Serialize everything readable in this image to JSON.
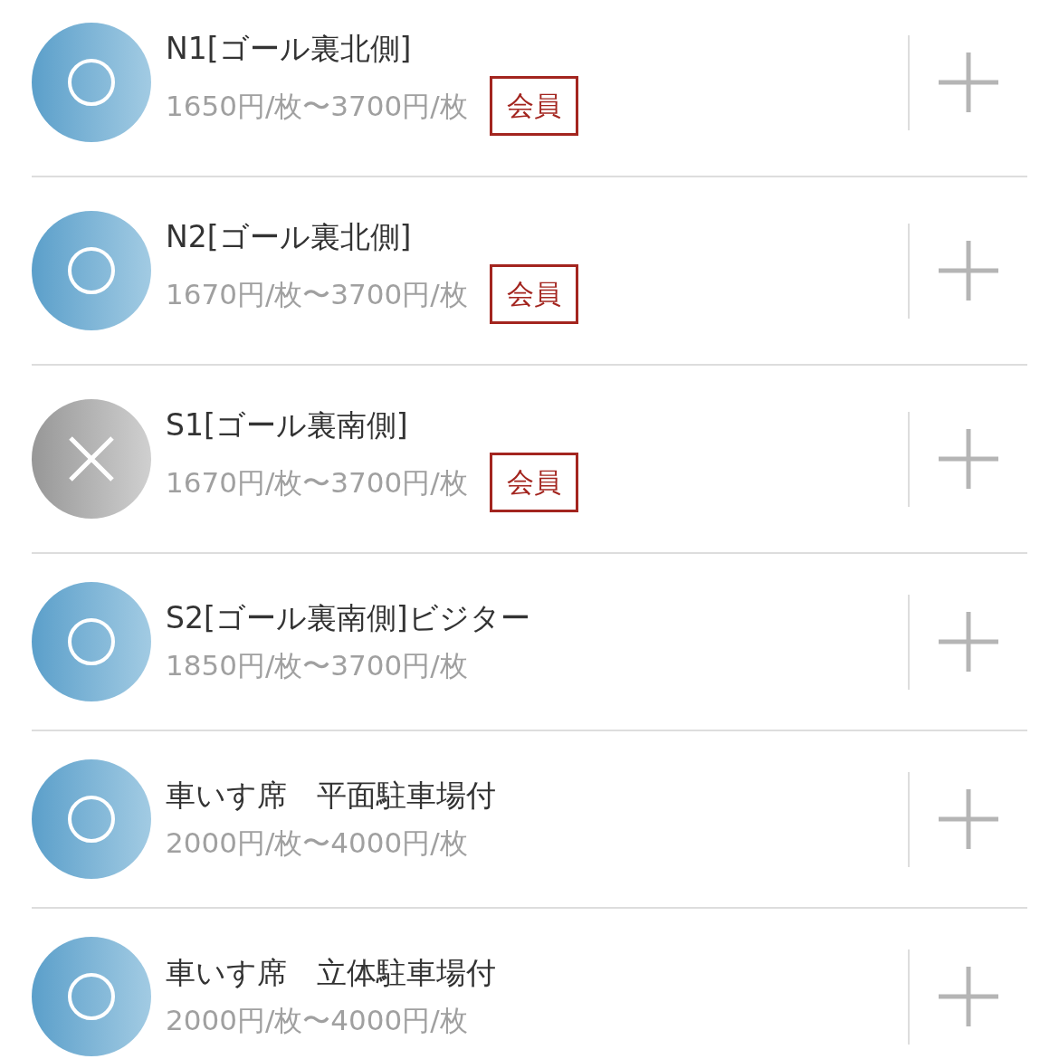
{
  "seats": [
    {
      "available": true,
      "name": "N1[ゴール裏北側]",
      "price": "1650円/枚〜3700円/枚",
      "badge": "会員"
    },
    {
      "available": true,
      "name": "N2[ゴール裏北側]",
      "price": "1670円/枚〜3700円/枚",
      "badge": "会員"
    },
    {
      "available": false,
      "name": "S1[ゴール裏南側]",
      "price": "1670円/枚〜3700円/枚",
      "badge": "会員"
    },
    {
      "available": true,
      "name": "S2[ゴール裏南側]ビジター",
      "price": "1850円/枚〜3700円/枚"
    },
    {
      "available": true,
      "name": "車いす席　平面駐車場付",
      "price": "2000円/枚〜4000円/枚"
    },
    {
      "available": true,
      "name": "車いす席　立体駐車場付",
      "price": "2000円/枚〜4000円/枚"
    }
  ]
}
